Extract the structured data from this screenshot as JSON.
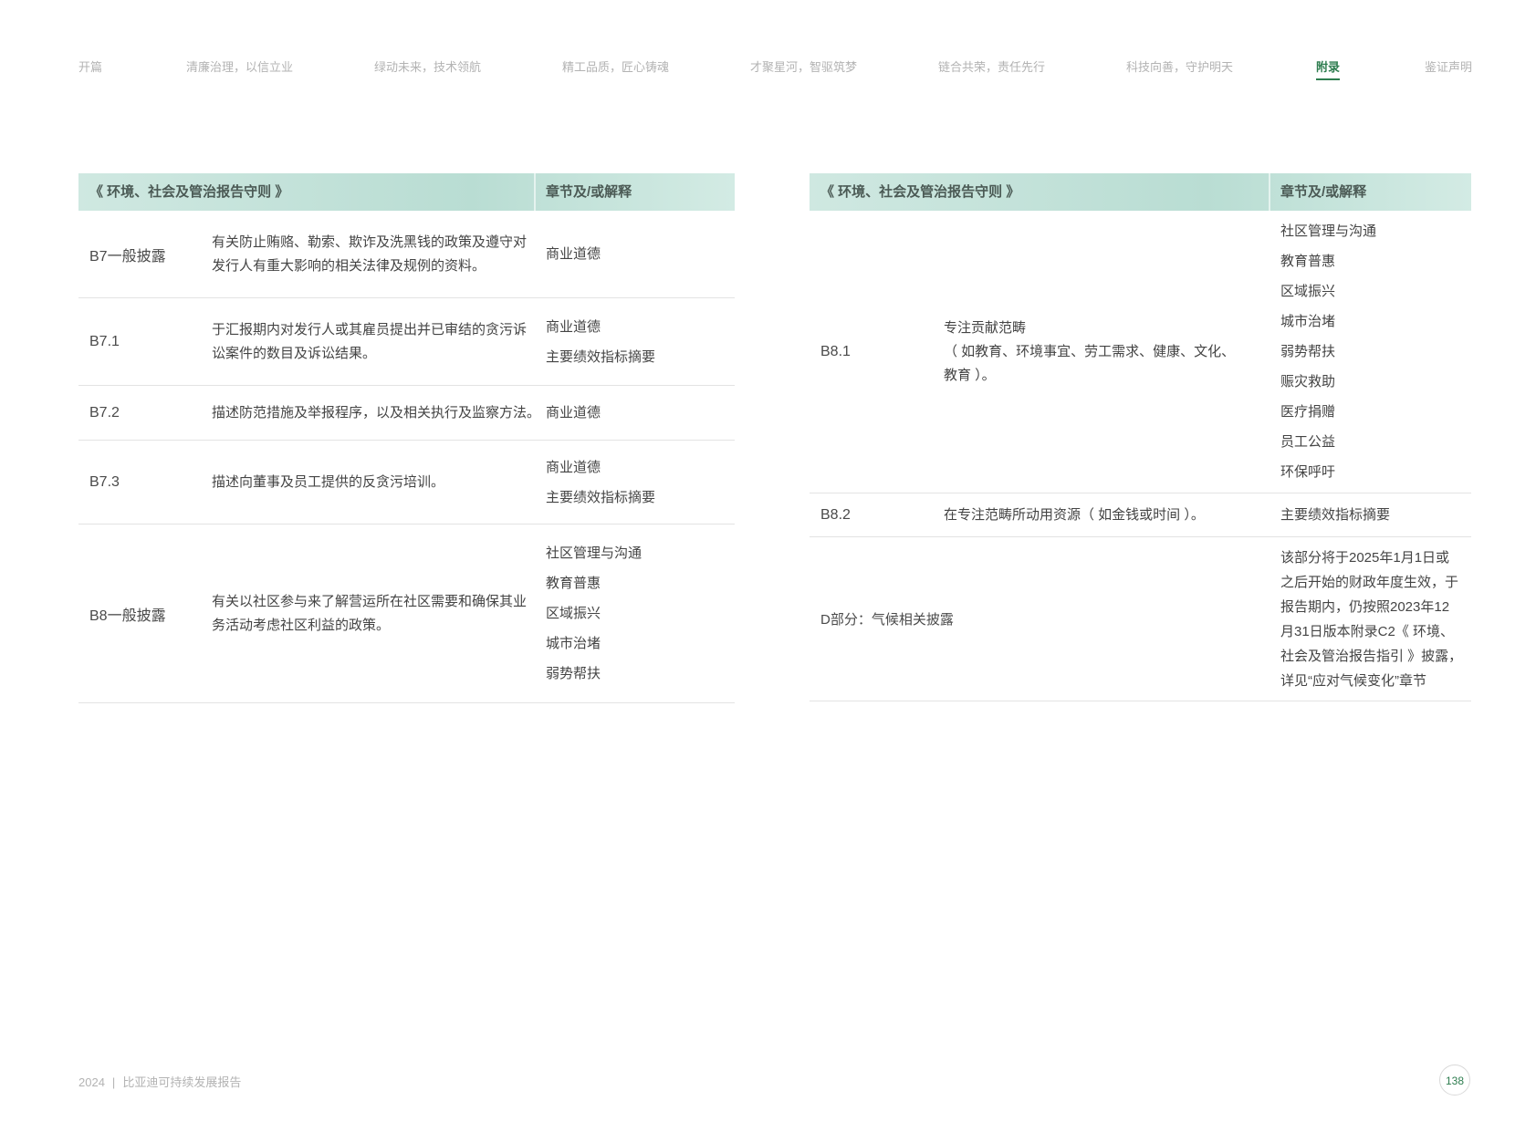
{
  "nav": {
    "items": [
      {
        "label": "开篇"
      },
      {
        "label": "清廉治理，以信立业"
      },
      {
        "label": "绿动未来，技术领航"
      },
      {
        "label": "精工品质，匠心铸魂"
      },
      {
        "label": "才聚星河，智驱筑梦"
      },
      {
        "label": "链合共荣，责任先行"
      },
      {
        "label": "科技向善，守护明天"
      },
      {
        "label": "附录"
      },
      {
        "label": "鉴证声明"
      }
    ],
    "active_index": 7
  },
  "left_table": {
    "header": {
      "guide": "《 环境、社会及管治报告守则 》",
      "chapter": "章节及/或解释"
    },
    "rows": [
      {
        "code": "B7一般披露",
        "desc_lines": [
          "有关防止贿赂、勒索、欺诈及洗黑钱的政策及遵守对",
          "发行人有重大影响的相关法律及规例的资料。"
        ],
        "chapters": [
          "商业道德"
        ]
      },
      {
        "code": "B7.1",
        "desc_lines": [
          "于汇报期内对发行人或其雇员提出并已审结的贪污诉",
          "讼案件的数目及诉讼结果。"
        ],
        "chapters": [
          "商业道德",
          "主要绩效指标摘要"
        ]
      },
      {
        "code": "B7.2",
        "desc_lines": [
          "描述防范措施及举报程序，以及相关执行及监察方法。"
        ],
        "chapters": [
          "商业道德"
        ]
      },
      {
        "code": "B7.3",
        "desc_lines": [
          "描述向董事及员工提供的反贪污培训。"
        ],
        "chapters": [
          "商业道德",
          "主要绩效指标摘要"
        ]
      },
      {
        "code": "B8一般披露",
        "desc_lines": [
          "有关以社区参与来了解营运所在社区需要和确保其业",
          "务活动考虑社区利益的政策。"
        ],
        "chapters": [
          "社区管理与沟通",
          "教育普惠",
          "区域振兴",
          "城市治堵",
          "弱势帮扶"
        ]
      }
    ]
  },
  "right_table": {
    "header": {
      "guide": "《 环境、社会及管治报告守则 》",
      "chapter": "章节及/或解释"
    },
    "rows": [
      {
        "code": "B8.1",
        "desc_lines": [
          "专注贡献范畴",
          "（ 如教育、环境事宜、劳工需求、健康、文化、",
          "教育 ）。"
        ],
        "chapters": [
          "社区管理与沟通",
          "教育普惠",
          "区域振兴",
          "城市治堵",
          "弱势帮扶",
          "赈灾救助",
          "医疗捐赠",
          "员工公益",
          "环保呼吁"
        ]
      },
      {
        "code": "B8.2",
        "desc_lines": [
          "在专注范畴所动用资源（ 如金钱或时间 ）。"
        ],
        "chapters": [
          "主要绩效指标摘要"
        ]
      },
      {
        "code": "D部分：气候相关披露",
        "desc_lines": [],
        "note_lines": [
          "该部分将于2025年1月1日或",
          "之后开始的财政年度生效，于",
          "报告期内，仍按照2023年12",
          "月31日版本附录C2《 环境、",
          "社会及管治报告指引 》披露，",
          "详见“应对气候变化”章节"
        ]
      }
    ]
  },
  "footer": {
    "year": "2024",
    "separator": "|",
    "report_title": "比亚迪可持续发展报告",
    "page_number": "138"
  }
}
